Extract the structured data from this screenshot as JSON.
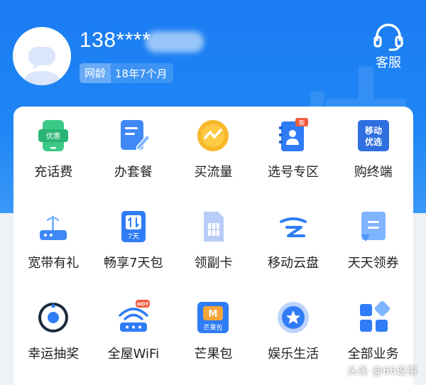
{
  "header": {
    "phone_number": "138****",
    "tenure_label": "网龄",
    "tenure_value": "18年7个月",
    "service_label": "客服"
  },
  "colors": {
    "header_blue": "#1a7cf2",
    "accent_blue": "#2f7cf6",
    "green": "#33c27a",
    "orange": "#f5a623"
  },
  "grid": {
    "items": [
      {
        "label": "充话费",
        "icon": "phone-topup-icon",
        "badge": "优惠"
      },
      {
        "label": "办套餐",
        "icon": "plan-edit-icon"
      },
      {
        "label": "买流量",
        "icon": "data-traffic-icon"
      },
      {
        "label": "选号专区",
        "icon": "number-select-icon",
        "badge": "靓"
      },
      {
        "label": "购终端",
        "icon": "mobile-selected-icon",
        "badge_line1": "移动",
        "badge_line2": "优选"
      },
      {
        "label": "宽带有礼",
        "icon": "router-icon"
      },
      {
        "label": "畅享7天包",
        "icon": "seven-day-pack-icon",
        "badge": "7天"
      },
      {
        "label": "领副卡",
        "icon": "sim-card-icon"
      },
      {
        "label": "移动云盘",
        "icon": "cloud-drive-icon"
      },
      {
        "label": "天天领券",
        "icon": "coupon-icon"
      },
      {
        "label": "幸运抽奖",
        "icon": "lucky-draw-icon"
      },
      {
        "label": "全屋WiFi",
        "icon": "home-wifi-icon",
        "badge": "HOT"
      },
      {
        "label": "芒果包",
        "icon": "mango-pack-icon",
        "badge": "芒果包"
      },
      {
        "label": "娱乐生活",
        "icon": "entertainment-star-icon"
      },
      {
        "label": "全部业务",
        "icon": "all-services-icon"
      }
    ]
  },
  "watermark": "头条 @66说事"
}
